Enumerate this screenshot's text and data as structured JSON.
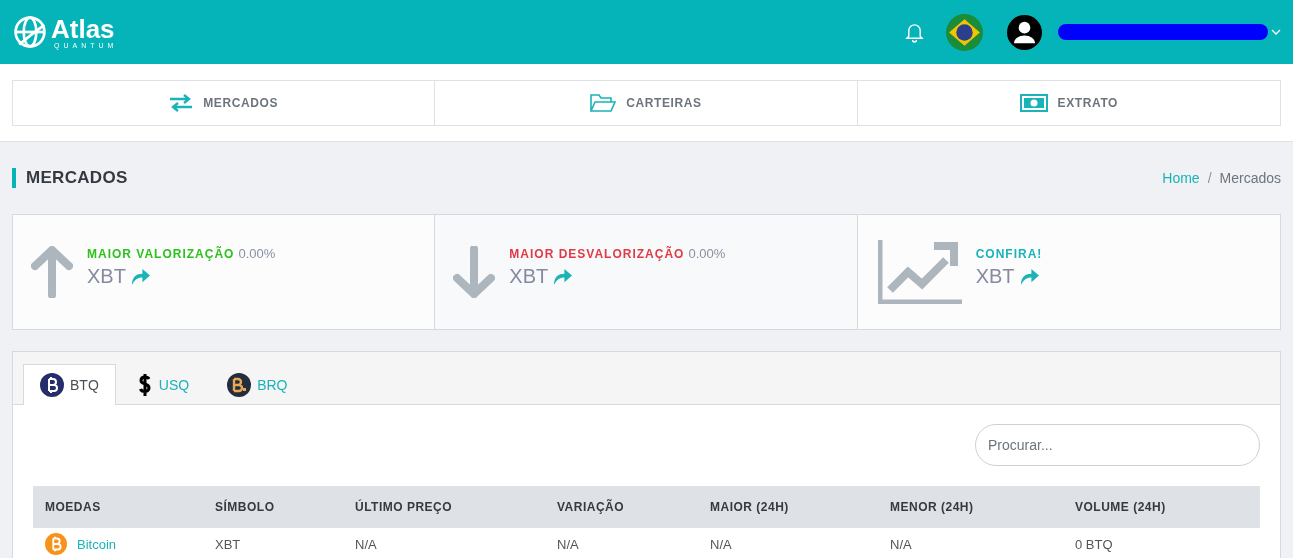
{
  "header": {
    "logo": {
      "name": "Atlas",
      "tagline": "QUANTUM"
    }
  },
  "nav": [
    {
      "kind": "arrows",
      "label": "MERCADOS"
    },
    {
      "kind": "folder",
      "label": "CARTEIRAS"
    },
    {
      "kind": "money",
      "label": "EXTRATO"
    }
  ],
  "page": {
    "title": "MERCADOS",
    "separator": "/",
    "breadcrumb": [
      {
        "label": "Home",
        "link": true
      },
      {
        "label": "Mercados",
        "link": false
      }
    ]
  },
  "stats": [
    {
      "kind": "up",
      "label": "MAIOR VALORIZAÇÃO",
      "value": "0.00%",
      "symbol": "XBT"
    },
    {
      "kind": "down",
      "label": "MAIOR DESVALORIZAÇÃO",
      "value": "0.00%",
      "symbol": "XBT"
    },
    {
      "kind": "chart",
      "label": "CONFIRA!",
      "symbol": "XBT"
    }
  ],
  "tabs": [
    {
      "kind": "btq",
      "label": "BTQ",
      "selected": true
    },
    {
      "kind": "usq",
      "label": "USQ",
      "selected": false
    },
    {
      "kind": "brq",
      "label": "BRQ",
      "selected": false
    }
  ],
  "search": {
    "placeholder": "Procurar..."
  },
  "table": {
    "columns": [
      "MOEDAS",
      "SÍMBOLO",
      "ÚLTIMO PREÇO",
      "VARIAÇÃO",
      "MAIOR (24H)",
      "MENOR (24H)",
      "VOLUME (24H)"
    ],
    "rows": [
      {
        "cells": [
          "Bitcoin",
          "XBT",
          "N/A",
          "N/A",
          "N/A",
          "N/A",
          "0 BTQ"
        ]
      }
    ]
  }
}
